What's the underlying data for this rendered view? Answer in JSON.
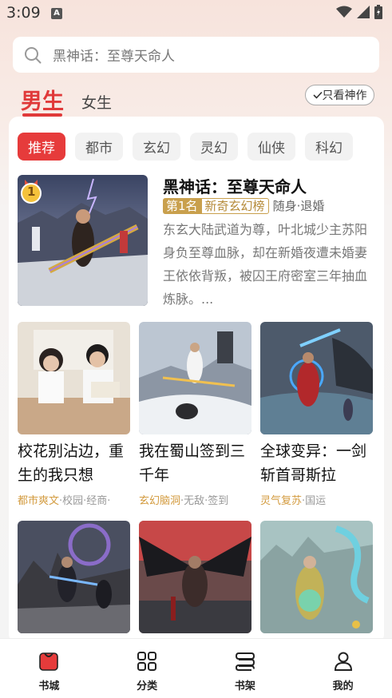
{
  "status_bar": {
    "time": "3:09",
    "notif_letter": "A"
  },
  "search": {
    "placeholder": "黑神话：至尊天命人"
  },
  "gender_tabs": {
    "male": "男生",
    "female": "女生"
  },
  "filter_button": "只看神作",
  "categories": [
    "推荐",
    "都市",
    "玄幻",
    "灵幻",
    "仙侠",
    "科幻"
  ],
  "featured": {
    "rank_number": "1",
    "title": "黑神话：至尊天命人",
    "rank_label": "第1名",
    "rank_list": "新奇玄幻榜",
    "genre": "随身·退婚",
    "description": "东玄大陆武道为尊，叶北城少主苏阳身负至尊血脉，却在新婚夜遭未婚妻王依依背叛，被囚王府密室三年抽血炼脉。..."
  },
  "books_row1": [
    {
      "title": "校花别沾边，重生的我只想",
      "category": "都市爽文",
      "tags": "·校园·经商·"
    },
    {
      "title": "我在蜀山签到三千年",
      "category": "玄幻脑洞",
      "tags": "·无敌·签到"
    },
    {
      "title": "全球变异：一剑斩首哥斯拉",
      "category": "灵气复苏",
      "tags": "·国运"
    }
  ],
  "bottom_nav": {
    "bookstore": "书城",
    "category": "分类",
    "shelf": "书架",
    "mine": "我的"
  },
  "colors": {
    "accent": "#e63b3b",
    "gold": "#c9a04d"
  }
}
